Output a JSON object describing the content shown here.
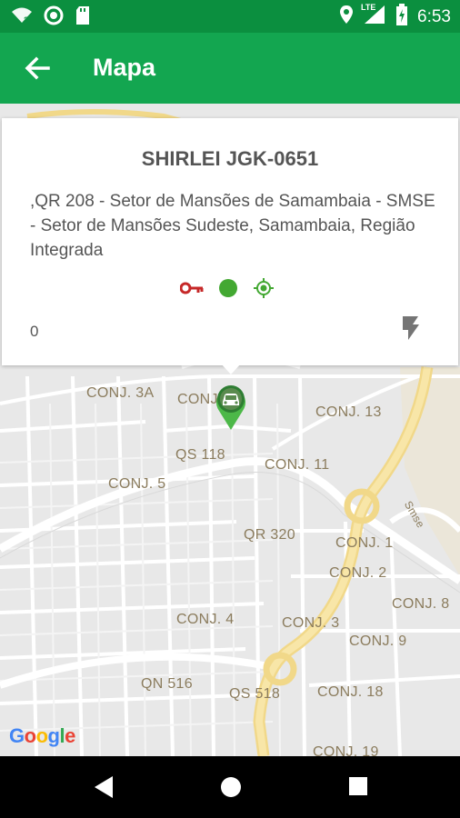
{
  "status_bar": {
    "time": "6:53",
    "network": "LTE",
    "icons": [
      "wifi-question-icon",
      "circle-notification-icon",
      "sd-card-icon",
      "location-icon",
      "signal-icon",
      "battery-charging-icon"
    ]
  },
  "app_bar": {
    "title": "Mapa",
    "back_icon": "arrow-back-icon"
  },
  "info_card": {
    "title": "SHIRLEI JGK-0651",
    "address": ",QR 208 - Setor de Mansões de Samambaia - SMSE - Setor de Mansões Sudeste, Samambaia, Região Integrada",
    "status_icons": [
      "key-icon",
      "status-dot-icon",
      "gps-target-icon"
    ],
    "count": "0",
    "action_icon": "flash-icon",
    "colors": {
      "key": "#c62828",
      "dot": "#43a832",
      "gps": "#43a832"
    }
  },
  "map": {
    "labels": [
      "CONJ. 3A",
      "CONJ",
      "CONJ. 13",
      "QS 118",
      "CONJ. 11",
      "CONJ. 5",
      "QR 320",
      "CONJ. 1",
      "CONJ. 2",
      "CONJ. 8",
      "CONJ. 4",
      "CONJ. 3",
      "CONJ. 9",
      "QN 516",
      "QS 518",
      "CONJ. 18",
      "CONJ. 19",
      "Smse"
    ],
    "marker_icon": "car-marker-icon",
    "attribution": "Google"
  },
  "nav_bar": {
    "buttons": [
      "back-nav-icon",
      "home-nav-icon",
      "recents-nav-icon"
    ]
  }
}
